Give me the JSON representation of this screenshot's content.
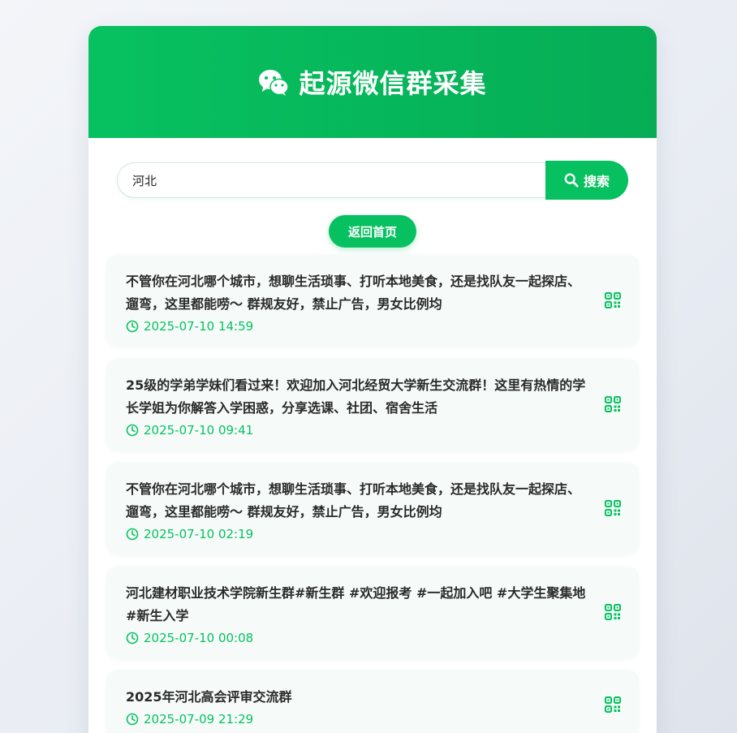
{
  "header": {
    "title": "起源微信群采集",
    "icon": "wechat-icon",
    "color": "#07c160"
  },
  "search": {
    "value": "河北",
    "button_label": "搜索",
    "button_icon": "search-icon"
  },
  "home_button": {
    "label": "返回首页"
  },
  "groups": [
    {
      "title": "不管你在河北哪个城市，想聊生活琐事、打听本地美食，还是找队友一起探店、遛弯，这里都能唠～ 群规友好，禁止广告，男女比例均",
      "time": "2025-07-10 14:59"
    },
    {
      "title": "25级的学弟学妹们看过来！欢迎加入河北经贸大学新生交流群！这里有热情的学长学姐为你解答入学困惑，分享选课、社团、宿舍生活",
      "time": "2025-07-10 09:41"
    },
    {
      "title": "不管你在河北哪个城市，想聊生活琐事、打听本地美食，还是找队友一起探店、遛弯，这里都能唠～ 群规友好，禁止广告，男女比例均",
      "time": "2025-07-10 02:19"
    },
    {
      "title": "河北建材职业技术学院新生群#新生群 #欢迎报考 #一起加入吧 #大学生聚集地 #新生入学",
      "time": "2025-07-10 00:08"
    },
    {
      "title": "2025年河北高会评审交流群",
      "time": "2025-07-09 21:29"
    }
  ]
}
